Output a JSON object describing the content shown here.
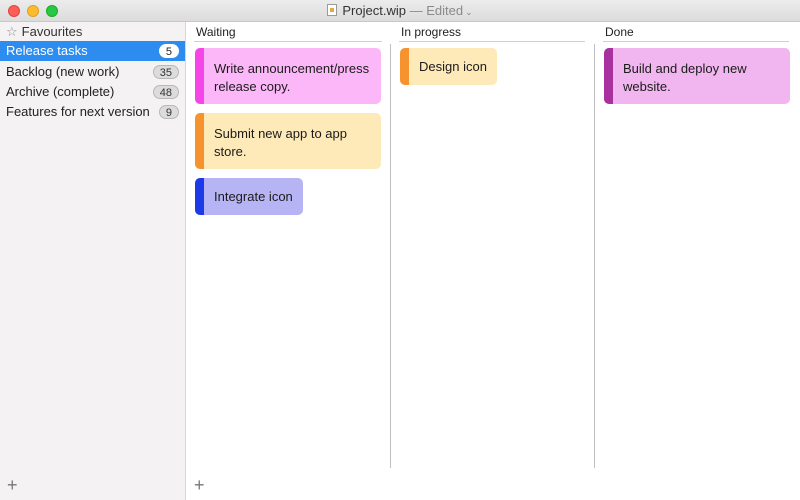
{
  "window": {
    "title": "Project.wip",
    "status": "— Edited",
    "chevron": "⌄"
  },
  "sidebar": {
    "favourites_label": "Favourites",
    "items": [
      {
        "label": "Release tasks",
        "count": "5",
        "selected": true
      },
      {
        "label": "Backlog (new work)",
        "count": "35"
      },
      {
        "label": "Archive (complete)",
        "count": "48"
      },
      {
        "label": "Features for next version",
        "count": "9"
      }
    ],
    "add_label": "+"
  },
  "board": {
    "columns": [
      {
        "title": "Waiting",
        "cards": [
          {
            "text": "Write announcement/press release copy.",
            "bg": "#fbb7f7",
            "bar": "#f545e8"
          },
          {
            "text": "Submit new app to app store.",
            "bg": "#fdeab8",
            "bar": "#f7932e"
          },
          {
            "text": "Integrate icon",
            "bg": "#b7b4f5",
            "bar": "#1d3ae8"
          }
        ]
      },
      {
        "title": "In progress",
        "cards": [
          {
            "text": "Design icon",
            "bg": "#fdeab8",
            "bar": "#f7932e"
          }
        ]
      },
      {
        "title": "Done",
        "cards": [
          {
            "text": "Build and deploy new website.",
            "bg": "#f1b6ef",
            "bar": "#a8309f"
          }
        ]
      }
    ],
    "add_label": "+"
  }
}
